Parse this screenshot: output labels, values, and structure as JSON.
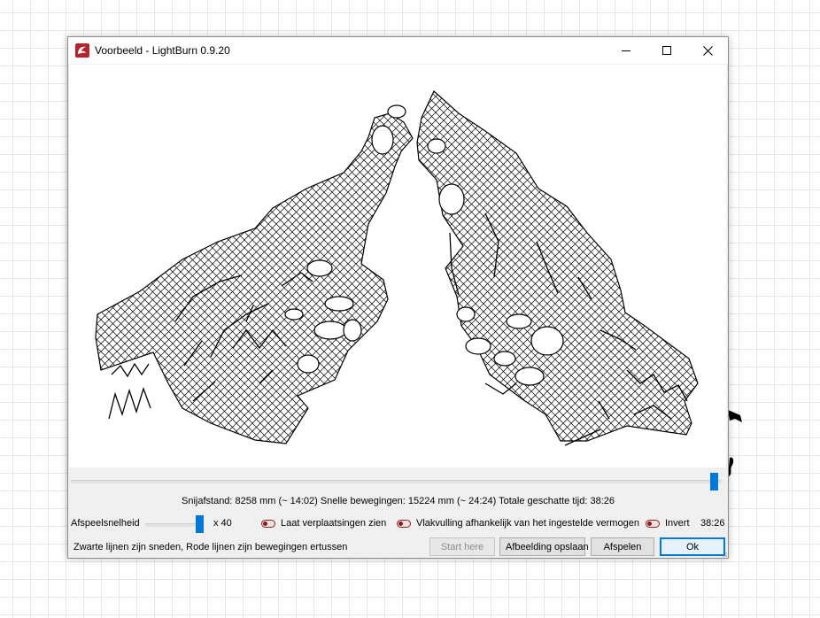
{
  "window": {
    "title": "Voorbeeld - LightBurn 0.9.20",
    "icon": "lightburn-app-icon",
    "controls": [
      "minimize-icon",
      "maximize-icon",
      "close-icon"
    ]
  },
  "preview": {
    "playback_position": 0.99
  },
  "stats": {
    "text": "Snijafstand: 8258 mm (~ 14:02) Snelle bewegingen: 15224 mm (~ 24:24) Totale geschatte tijd: 38:26"
  },
  "controls": {
    "speed_label": "Afspeelsnelheid",
    "speed_level": 1.0,
    "speed_multiplier": "x 40",
    "toggle_show_moves": "Laat verplaatsingen zien",
    "toggle_fill_power": "Vlakvulling afhankelijk van het ingestelde vermogen",
    "toggle_invert": "Invert",
    "time_readout": "38:26"
  },
  "footer": {
    "hint": "Zwarte lijnen zijn sneden, Rode lijnen zijn bewegingen ertussen",
    "start_here": "Start here",
    "save_image": "Afbeelding opslaan",
    "play": "Afspelen",
    "ok": "Ok"
  },
  "colors": {
    "accent": "#0078d7",
    "toggle_red": "#8b1a1a",
    "cut_lines": "#000000"
  }
}
